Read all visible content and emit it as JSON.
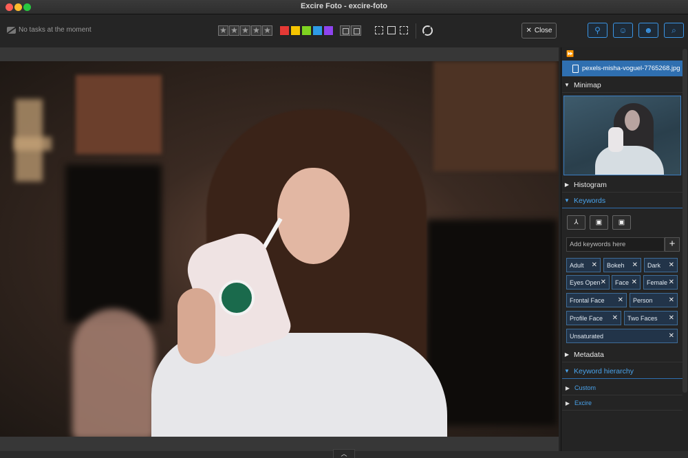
{
  "window": {
    "title": "Excire Foto - excire-foto"
  },
  "toolbar": {
    "tasks_text": "No tasks at the moment",
    "stars": [
      "★",
      "★",
      "★",
      "★",
      "★"
    ],
    "color_labels": [
      "#e53935",
      "#f5c400",
      "#7ed321",
      "#2e9be6",
      "#8e44ef"
    ],
    "close_label": "Close",
    "close_glyph": "✕"
  },
  "photo": {
    "filename": "pexels-misha-voguel-7765268.jpg"
  },
  "panel": {
    "expand_glyph": "⏩",
    "sections": {
      "minimap": "Minimap",
      "histogram": "Histogram",
      "keywords": "Keywords",
      "metadata": "Metadata",
      "keyword_hierarchy": "Keyword hierarchy"
    },
    "keywords": {
      "placeholder": "Add keywords here",
      "add_glyph": "+",
      "items": [
        "Adult",
        "Bokeh",
        "Dark",
        "Eyes Open",
        "Face",
        "Female",
        "Frontal Face",
        "Person",
        "Profile Face",
        "Two Faces",
        "Unsaturated"
      ],
      "remove_glyph": "✕"
    },
    "hierarchy": [
      "Custom",
      "Excire"
    ]
  },
  "footer": {
    "collapse_glyph": "︿"
  }
}
